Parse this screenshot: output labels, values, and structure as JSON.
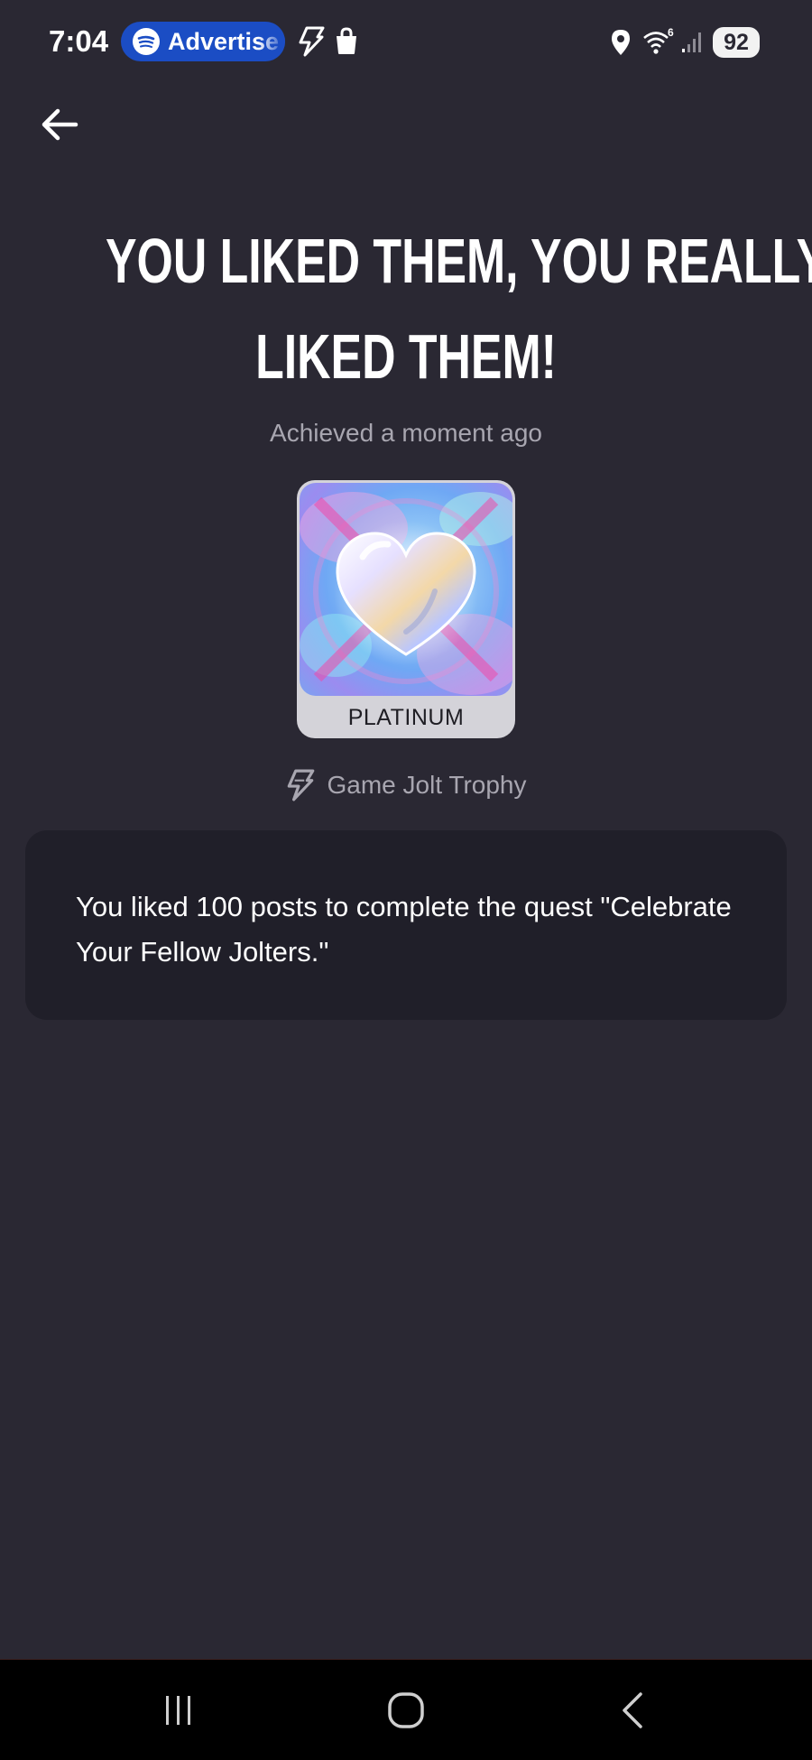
{
  "status_bar": {
    "time": "7:04",
    "spotify_label": "Advertise",
    "battery": "92",
    "icons": [
      "spotify-icon",
      "game-jolt-icon",
      "shopping-bag-icon",
      "location-icon",
      "wifi-icon",
      "signal-icon",
      "battery-icon"
    ]
  },
  "header": {
    "back_icon": "arrow-left-icon"
  },
  "trophy": {
    "title_line1": "YOU LIKED THEM, YOU REALLY",
    "title_line2": "LIKED THEM!",
    "achieved": "Achieved a moment ago",
    "tier": "PLATINUM",
    "image": "holographic-heart-trophy",
    "source_icon": "game-jolt-icon",
    "source": "Game Jolt Trophy",
    "description": "You liked 100 posts to complete the quest \"Celebrate Your Fellow Jolters.\""
  },
  "nav_bar": {
    "icons": [
      "recent-apps-icon",
      "home-icon",
      "back-icon"
    ]
  },
  "colors": {
    "background": "#2a2833",
    "card": "#201f29",
    "muted_text": "#a8a6b0",
    "spotify_pill": "#1b4dc4",
    "tier_label_bg": "#d4d3d9"
  }
}
